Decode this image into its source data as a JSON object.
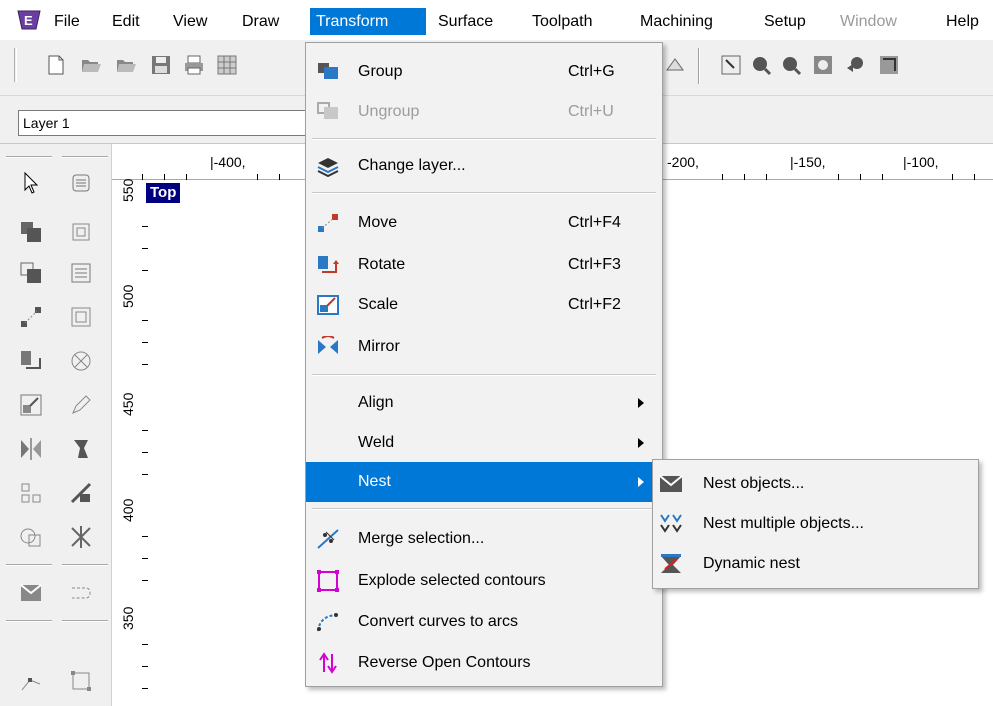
{
  "menubar": {
    "app_icon": "app-logo-icon",
    "items": [
      {
        "label": "File",
        "state": "normal"
      },
      {
        "label": "Edit",
        "state": "normal"
      },
      {
        "label": "View",
        "state": "normal"
      },
      {
        "label": "Draw",
        "state": "normal"
      },
      {
        "label": "Transform",
        "state": "active"
      },
      {
        "label": "Surface",
        "state": "normal"
      },
      {
        "label": "Toolpath",
        "state": "normal"
      },
      {
        "label": "Machining",
        "state": "normal"
      },
      {
        "label": "Setup",
        "state": "normal"
      },
      {
        "label": "Window",
        "state": "disabled"
      },
      {
        "label": "Help",
        "state": "normal"
      }
    ]
  },
  "layer": {
    "value": "Layer 1"
  },
  "ruler": {
    "h_labels": [
      "|-400,",
      "-200,",
      "|-150,",
      "|-100,"
    ],
    "v_labels": [
      "550",
      "500",
      "450",
      "400",
      "350"
    ]
  },
  "view_label": "Top",
  "transform_menu": {
    "items": [
      {
        "id": "group",
        "label": "Group",
        "shortcut": "Ctrl+G",
        "icon": "group-icon",
        "disabled": false
      },
      {
        "id": "ungroup",
        "label": "Ungroup",
        "shortcut": "Ctrl+U",
        "icon": "ungroup-icon",
        "disabled": true
      },
      {
        "id": "change-layer",
        "label": "Change layer...",
        "shortcut": "",
        "icon": "layers-icon",
        "disabled": false
      },
      {
        "id": "move",
        "label": "Move",
        "shortcut": "Ctrl+F4",
        "icon": "move-icon",
        "disabled": false
      },
      {
        "id": "rotate",
        "label": "Rotate",
        "shortcut": "Ctrl+F3",
        "icon": "rotate-icon",
        "disabled": false
      },
      {
        "id": "scale",
        "label": "Scale",
        "shortcut": "Ctrl+F2",
        "icon": "scale-icon",
        "disabled": false
      },
      {
        "id": "mirror",
        "label": "Mirror",
        "shortcut": "",
        "icon": "mirror-icon",
        "disabled": false
      },
      {
        "id": "align",
        "label": "Align",
        "submenu": true
      },
      {
        "id": "weld",
        "label": "Weld",
        "submenu": true
      },
      {
        "id": "nest",
        "label": "Nest",
        "submenu": true,
        "highlighted": true
      },
      {
        "id": "merge",
        "label": "Merge selection...",
        "icon": "merge-icon"
      },
      {
        "id": "explode",
        "label": "Explode selected contours",
        "icon": "explode-icon"
      },
      {
        "id": "convert",
        "label": "Convert curves to arcs",
        "icon": "curve-arc-icon"
      },
      {
        "id": "reverse",
        "label": "Reverse Open Contours",
        "icon": "reverse-icon"
      }
    ]
  },
  "nest_submenu": {
    "items": [
      {
        "label": "Nest objects...",
        "icon": "nest-objects-icon"
      },
      {
        "label": "Nest multiple objects...",
        "icon": "nest-multiple-icon"
      },
      {
        "label": "Dynamic nest",
        "icon": "dynamic-nest-icon"
      }
    ]
  },
  "colors": {
    "accent": "#0078d7",
    "view_tag": "#000080",
    "menu_bg": "#f2f2f2"
  }
}
